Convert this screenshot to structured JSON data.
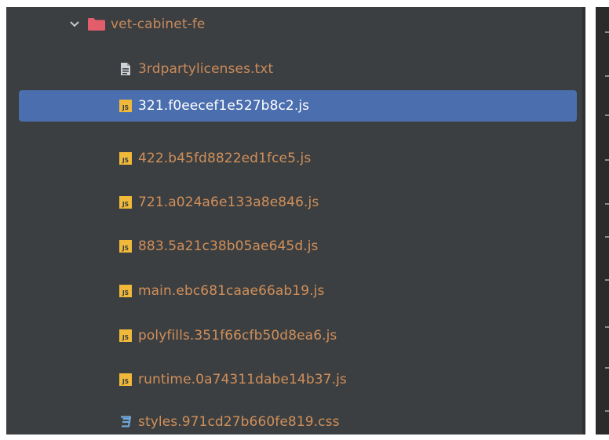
{
  "project_tree": {
    "folder": {
      "name": "vet-cabinet-fe",
      "expanded": true,
      "icon": "folder-icon",
      "color": "#e35d6a"
    },
    "files": [
      {
        "name": "3rdpartylicenses.txt",
        "icon": "text-file-icon",
        "selected": false
      },
      {
        "name": "321.f0eecef1e527b8c2.js",
        "icon": "js-file-icon",
        "selected": true
      },
      {
        "name": "422.b45fd8822ed1fce5.js",
        "icon": "js-file-icon",
        "selected": false
      },
      {
        "name": "721.a024a6e133a8e846.js",
        "icon": "js-file-icon",
        "selected": false
      },
      {
        "name": "883.5a21c38b05ae645d.js",
        "icon": "js-file-icon",
        "selected": false
      },
      {
        "name": "main.ebc681caae66ab19.js",
        "icon": "js-file-icon",
        "selected": false
      },
      {
        "name": "polyfills.351f66cfb50d8ea6.js",
        "icon": "js-file-icon",
        "selected": false
      },
      {
        "name": "runtime.0a74311dabe14b37.js",
        "icon": "js-file-icon",
        "selected": false
      },
      {
        "name": "styles.971cd27b660fe819.css",
        "icon": "css-file-icon",
        "selected": false
      }
    ]
  },
  "colors": {
    "panel_background": "#3c3f41",
    "selection": "#4b6eaf",
    "file_label": "#d08f5a",
    "js_badge": "#f0b93a",
    "css_icon": "#6fa8dc"
  }
}
